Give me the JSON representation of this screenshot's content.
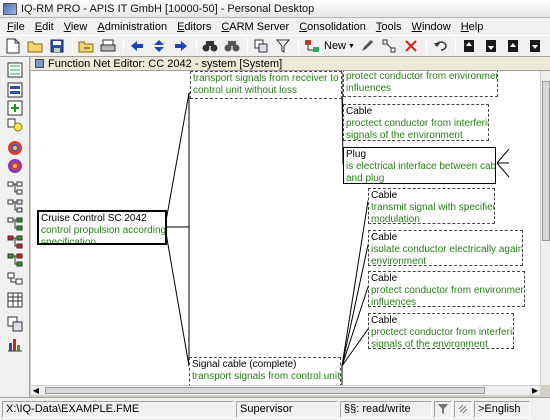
{
  "window": {
    "title": "IQ-RM PRO - APIS IT GmbH [10000-50] - Personal Desktop"
  },
  "menu": [
    {
      "u": "F",
      "rest": "ile"
    },
    {
      "u": "E",
      "rest": "dit"
    },
    {
      "u": "V",
      "rest": "iew"
    },
    {
      "u": "A",
      "rest": "dministration"
    },
    {
      "u": "E",
      "rest": "ditors"
    },
    {
      "u": "C",
      "rest": "ARM Server"
    },
    {
      "u": "C",
      "rest": "onsolidation"
    },
    {
      "u": "T",
      "rest": "ools"
    },
    {
      "u": "W",
      "rest": "indow"
    },
    {
      "u": "H",
      "rest": "elp"
    }
  ],
  "toolbar": {
    "new_label": "New",
    "icons": [
      "new-document-icon",
      "open-folder-icon",
      "save-icon",
      "open-file-icon",
      "print-icon",
      "back-arrow-icon",
      "collapse-icon",
      "forward-arrow-icon",
      "find-icon",
      "find-next-icon",
      "insert-structure-icon",
      "filter-icon",
      "new-element-icon",
      "pen-icon",
      "connect-icon",
      "delete-link-icon",
      "undo-icon",
      "move-top-icon",
      "move-bottom-icon",
      "move-up-icon",
      "move-down-icon"
    ]
  },
  "editor": {
    "title": "Function Net Editor: CC 2042 - system [System]"
  },
  "nodes": {
    "root": {
      "title": "Cruise Control SC 2042",
      "desc": "control propulsion according to\nspecification"
    },
    "sig_top": {
      "title": "",
      "desc": "transport signals from receiver to\ncontrol unit without loss"
    },
    "protect_top": {
      "title": "",
      "desc": "protect conductor from environmental\ninfluences"
    },
    "cable_a": {
      "title": "Cable",
      "desc": "proctect conductor from interfering\nsignals of the environment"
    },
    "plug": {
      "title": "Plug",
      "desc": "is electrical interface between cable\nand plug"
    },
    "cable_b": {
      "title": "Cable",
      "desc": "transmit signal with specified\nmodulation"
    },
    "cable_c": {
      "title": "Cable",
      "desc": "isolate conductor electrically against\nenvironment"
    },
    "cable_d": {
      "title": "Cable",
      "desc": "protect conductor from environmental\ninfluences"
    },
    "cable_e": {
      "title": "Cable",
      "desc": "proctect conductor from interfering\nsignals of the environment"
    },
    "sig_bottom": {
      "title": "Signal cable (complete)",
      "desc": "transport signals from control unit to"
    }
  },
  "status": {
    "path": "X:\\IQ-Data\\EXAMPLE.FME",
    "user": "Supervisor",
    "access": "§§: read/write",
    "language": ">English"
  }
}
